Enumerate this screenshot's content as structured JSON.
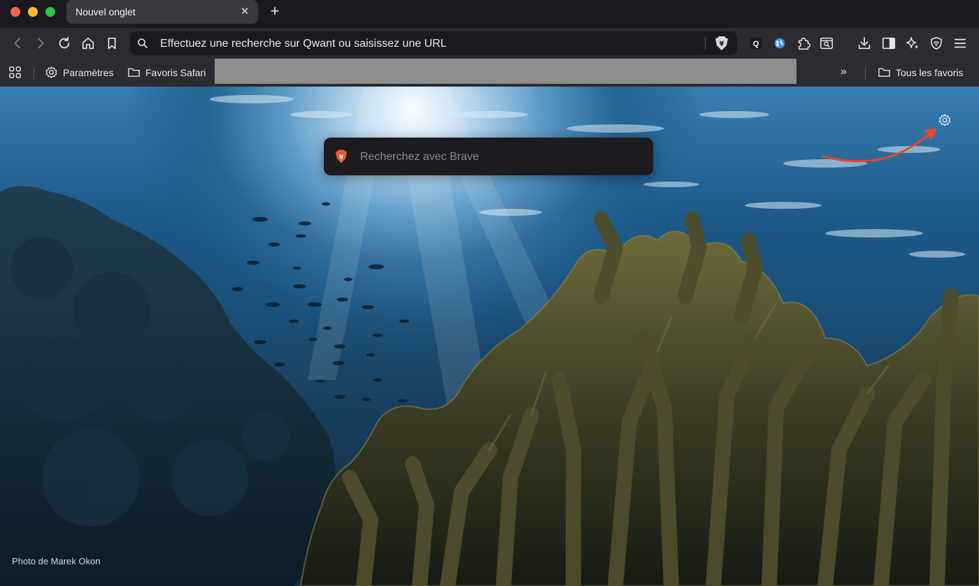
{
  "window": {
    "tab_title": "Nouvel onglet",
    "close_glyph": "✕",
    "new_tab_glyph": "+"
  },
  "toolbar": {
    "address_text": "Effectuez une recherche sur Qwant ou saisissez une URL"
  },
  "bookmarks": {
    "settings_label": "Paramètres",
    "safari_folder_label": "Favoris Safari",
    "overflow_glyph": "»",
    "all_bookmarks_label": "Tous les favoris"
  },
  "new_tab_page": {
    "search_placeholder": "Recherchez avec Brave",
    "photo_credit": "Photo de Marek Okon"
  },
  "colors": {
    "annotation_arrow": "#e8452c",
    "brave_orange": "#fb542b"
  }
}
